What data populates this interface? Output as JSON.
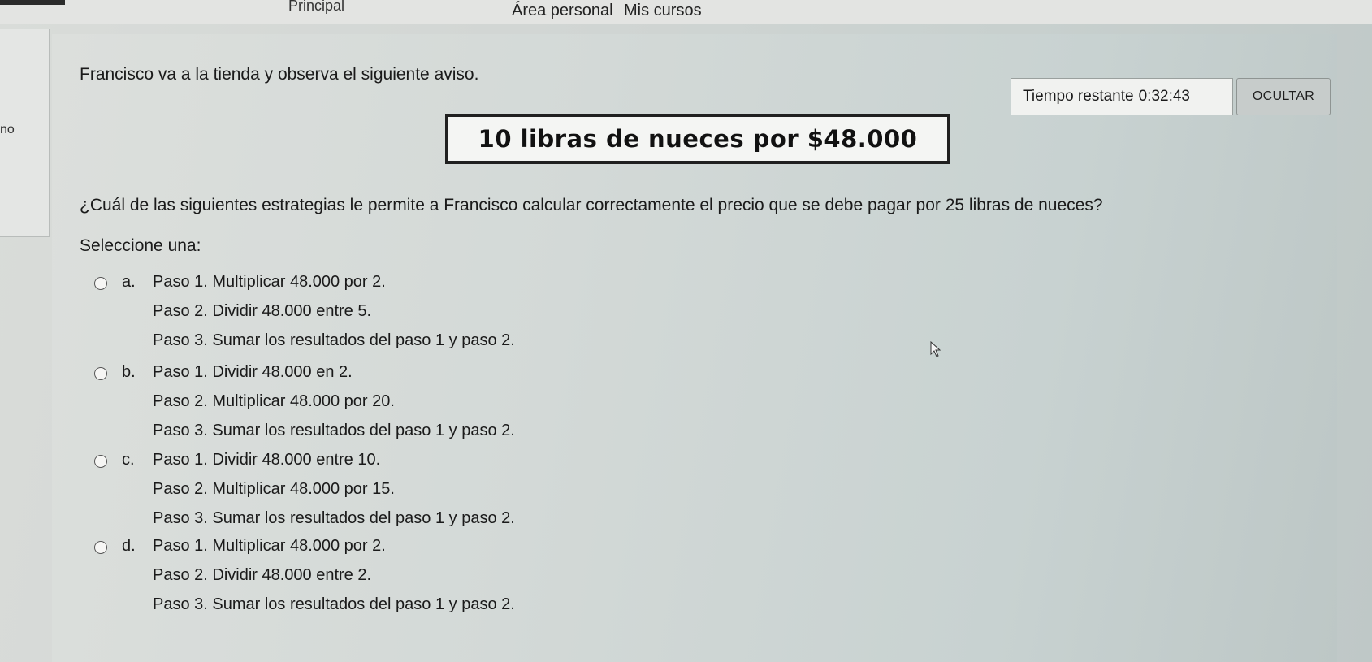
{
  "nav": {
    "cut_item": "Principal",
    "area_personal": "Área personal",
    "mis_cursos": "Mis cursos"
  },
  "left_panel": {
    "fragment": "no"
  },
  "question": {
    "intro": "Francisco va a la tienda y observa el siguiente aviso.",
    "notice": "10 libras de nueces por $48.000",
    "text": "¿Cuál de las siguientes estrategias le permite a Francisco calcular correctamente el precio que se debe pagar por 25 libras de nueces?",
    "prompt": "Seleccione una:"
  },
  "timer": {
    "label": "Tiempo restante",
    "value": "0:32:43",
    "hide_label": "OCULTAR"
  },
  "options": [
    {
      "letter": "a.",
      "steps": [
        "Paso 1. Multiplicar 48.000 por 2.",
        "Paso 2. Dividir 48.000 entre 5.",
        "Paso 3. Sumar los resultados del paso 1 y paso 2."
      ]
    },
    {
      "letter": "b.",
      "steps": [
        "Paso 1. Dividir 48.000 en 2.",
        "Paso 2. Multiplicar 48.000 por 20.",
        "Paso 3. Sumar los resultados del paso 1 y paso 2."
      ]
    },
    {
      "letter": "c.",
      "steps": [
        "Paso 1. Dividir 48.000 entre 10.",
        "Paso 2. Multiplicar 48.000 por 15.",
        "Paso 3. Sumar los resultados del paso 1 y paso 2."
      ]
    },
    {
      "letter": "d.",
      "steps": [
        "Paso 1. Multiplicar 48.000 por 2.",
        "Paso 2. Dividir 48.000 entre 2.",
        "Paso 3. Sumar los resultados del paso 1 y paso 2."
      ]
    }
  ]
}
